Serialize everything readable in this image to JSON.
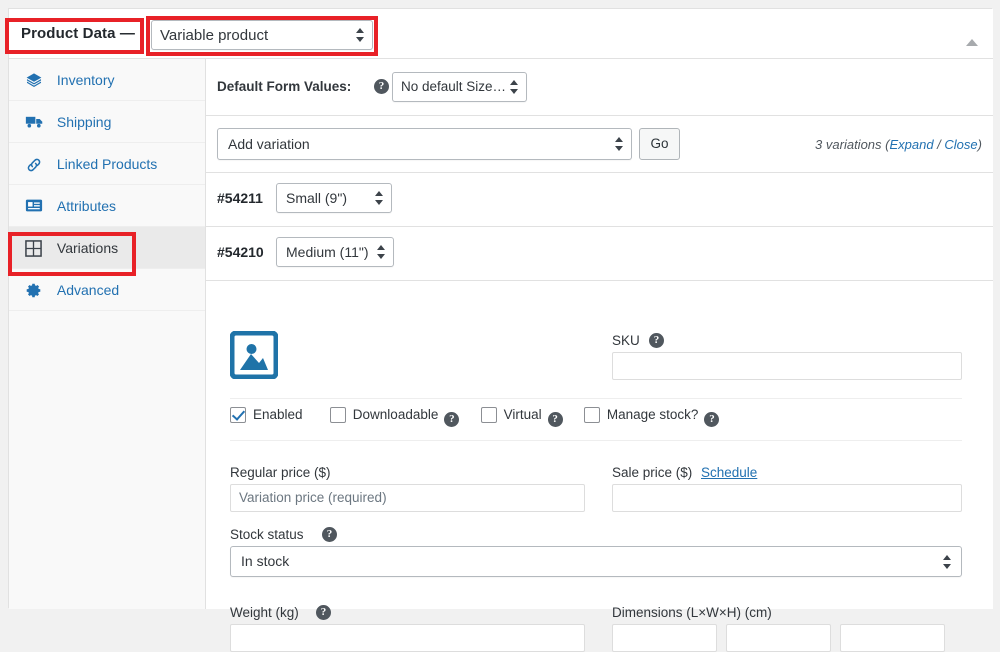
{
  "panel": {
    "title": "Product Data —",
    "product_type": "Variable product",
    "collapse_icon": "chevron-up-icon"
  },
  "sidebar": {
    "items": [
      {
        "label": "Inventory",
        "icon": "inventory-icon",
        "active": false
      },
      {
        "label": "Shipping",
        "icon": "truck-icon",
        "active": false
      },
      {
        "label": "Linked Products",
        "icon": "link-icon",
        "active": false
      },
      {
        "label": "Attributes",
        "icon": "attributes-icon",
        "active": false
      },
      {
        "label": "Variations",
        "icon": "grid-icon",
        "active": true
      },
      {
        "label": "Advanced",
        "icon": "gear-icon",
        "active": false
      }
    ]
  },
  "defaults_row": {
    "label": "Default Form Values:",
    "help_icon": "help-icon",
    "select_value": "No default Size…"
  },
  "add_row": {
    "select_value": "Add variation",
    "go_label": "Go",
    "count_text": "3 variations (",
    "expand_label": "Expand",
    "separator": " / ",
    "close_label": "Close",
    "count_suffix": ")"
  },
  "variations": [
    {
      "id": "#54211",
      "attribute": "Small (9\")",
      "expanded": false
    },
    {
      "id": "#54210",
      "attribute": "Medium (11\")",
      "expanded": true
    }
  ],
  "detail": {
    "image_placeholder_icon": "image-placeholder-icon",
    "sku_label": "SKU",
    "sku_help_icon": "help-icon",
    "sku_value": "",
    "checkboxes": [
      {
        "label": "Enabled",
        "checked": true,
        "help": false
      },
      {
        "label": "Downloadable",
        "checked": false,
        "help": true
      },
      {
        "label": "Virtual",
        "checked": false,
        "help": true
      },
      {
        "label": "Manage stock?",
        "checked": false,
        "help": true
      }
    ],
    "regular_price_label": "Regular price ($)",
    "regular_price_placeholder": "Variation price (required)",
    "sale_price_label": "Sale price ($)",
    "schedule_label": "Schedule",
    "sale_price_value": "",
    "stock_status_label": "Stock status",
    "stock_status_help_icon": "help-icon",
    "stock_status_value": "In stock",
    "weight_label": "Weight (kg)",
    "weight_help_icon": "help-icon",
    "dimensions_label": "Dimensions (L×W×H) (cm)"
  },
  "colors": {
    "link": "#2271b1",
    "annotation": "#e82127",
    "accent_icon": "#1f73a8"
  }
}
